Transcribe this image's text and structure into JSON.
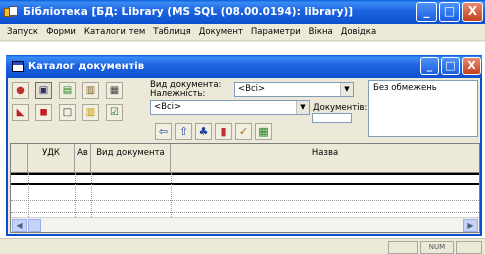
{
  "app": {
    "title": "Бібліотека [БД: Library (MS SQL (08.00.0194): library)]",
    "window_buttons": {
      "minimize": "_",
      "maximize": "□",
      "close": "X"
    }
  },
  "menu": {
    "items": [
      "Запуск",
      "Форми",
      "Каталоги тем",
      "Таблиця",
      "Документ",
      "Параметри",
      "Вікна",
      "Довідка"
    ]
  },
  "child_window": {
    "title": "Каталог документів",
    "window_buttons": {
      "minimize": "_",
      "maximize": "□",
      "close": "X"
    }
  },
  "filters": {
    "doc_type_label": "Вид документа:",
    "belongs_label": "Належність:",
    "doc_type_value": "<Всі>",
    "belongs_value": "<Всі>",
    "documents_label": "Документів:",
    "documents_count": "",
    "restriction_text": "Без обмежень"
  },
  "grid": {
    "columns": [
      "УДК",
      "Ав",
      "Вид документа",
      "Назва"
    ]
  },
  "status": {
    "num": "NUM"
  }
}
